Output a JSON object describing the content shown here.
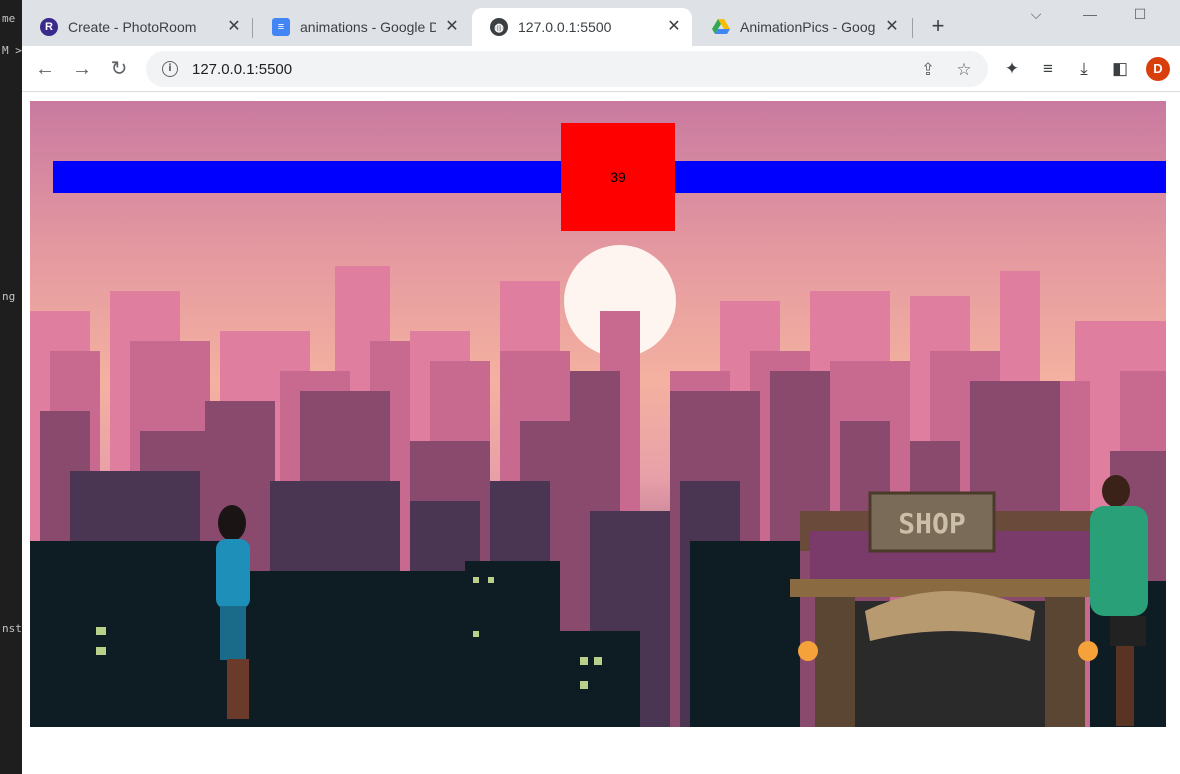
{
  "browser": {
    "tabs": [
      {
        "title": "Create - PhotoRoom",
        "favicon": "photoroom-icon",
        "active": false
      },
      {
        "title": "animations - Google Do",
        "favicon": "google-docs-icon",
        "active": false
      },
      {
        "title": "127.0.0.1:5500",
        "favicon": "globe-icon",
        "active": true
      },
      {
        "title": "AnimationPics - Google",
        "favicon": "google-drive-icon",
        "active": false
      }
    ],
    "address": "127.0.0.1:5500",
    "profile_initial": "D"
  },
  "game": {
    "timer": "39",
    "shop_sign": "SHOP"
  },
  "colors": {
    "health_bar": "#0000ff",
    "timer_box": "#ff0000"
  }
}
